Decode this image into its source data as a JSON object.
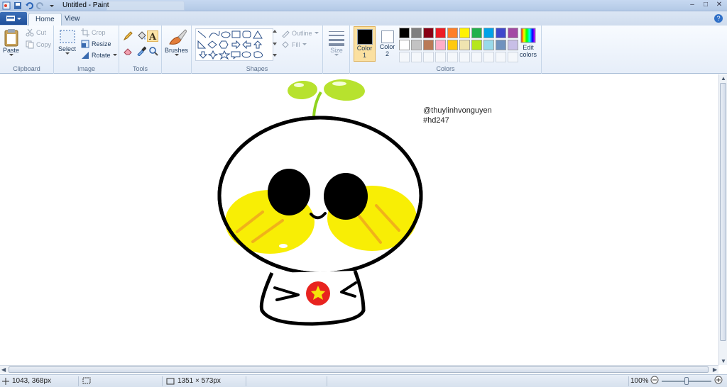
{
  "window": {
    "title": "Untitled - Paint",
    "min_glyph": "–",
    "max_glyph": "□",
    "close_glyph": "✕"
  },
  "tabs": [
    {
      "label": "Home",
      "active": true
    },
    {
      "label": "View",
      "active": false
    }
  ],
  "help_glyph": "?",
  "ribbon": {
    "clipboard": {
      "label": "Clipboard",
      "paste": "Paste",
      "cut": "Cut",
      "copy": "Copy"
    },
    "image": {
      "label": "Image",
      "select": "Select",
      "crop": "Crop",
      "resize": "Resize",
      "rotate": "Rotate"
    },
    "tools": {
      "label": "Tools"
    },
    "brushes": {
      "label": "Brushes"
    },
    "shapes": {
      "label": "Shapes",
      "outline": "Outline",
      "fill": "Fill"
    },
    "size": {
      "label": "Size"
    },
    "colors": {
      "label": "Colors",
      "color1": {
        "label": "Color",
        "num": "1",
        "value": "#000000"
      },
      "color2": {
        "label": "Color",
        "num": "2",
        "value": "#ffffff"
      },
      "edit": "Edit colors",
      "palette_row1": [
        "#000000",
        "#7f7f7f",
        "#880015",
        "#ed1c24",
        "#ff7f27",
        "#fff200",
        "#22b14c",
        "#00a2e8",
        "#3f48cc",
        "#a349a4"
      ],
      "palette_row2": [
        "#ffffff",
        "#c3c3c3",
        "#b97a57",
        "#ffaec9",
        "#ffc90e",
        "#efe4b0",
        "#b5e61d",
        "#99d9ea",
        "#7092be",
        "#c8bfe7"
      ]
    }
  },
  "canvas": {
    "watermark_line1": "@thuylinhvonguyen",
    "watermark_line2": "#hd247"
  },
  "status": {
    "cursor_pos": "1043, 368px",
    "image_size": "1351 × 573px",
    "zoom": "100%"
  }
}
